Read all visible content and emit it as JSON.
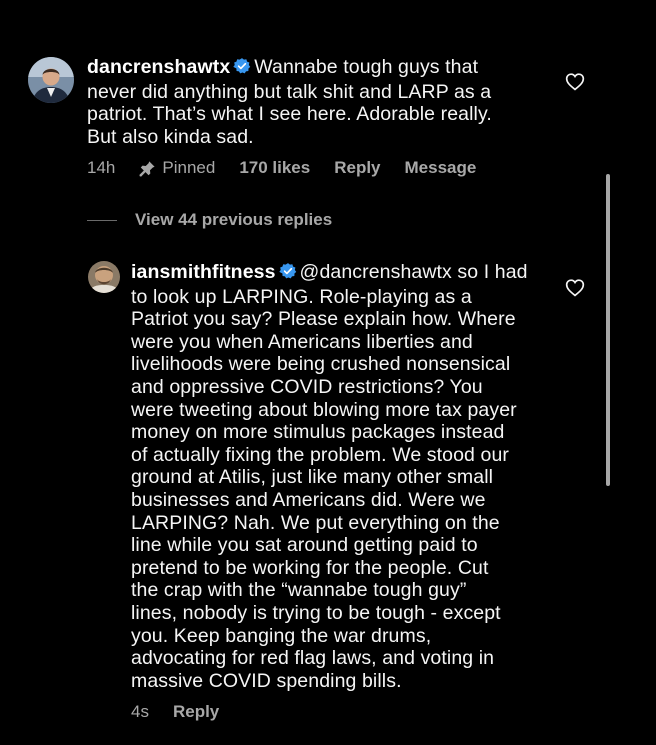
{
  "comment": {
    "username": "dancrenshawtx",
    "lines": [
      "Wannabe tough guys that",
      "never did anything but talk shit and LARP as a",
      "patriot. That’s what I see here. Adorable really.",
      "But also kinda sad."
    ],
    "time": "14h",
    "pinned_label": "Pinned",
    "likes": "170 likes",
    "reply_label": "Reply",
    "message_label": "Message"
  },
  "view_previous_replies": "View 44 previous replies",
  "reply": {
    "username": "iansmithfitness",
    "lines": [
      "@dancrenshawtx so I had",
      "to look up LARPING. Role-playing as a",
      "Patriot you say? Please explain how. Where",
      "were you when Americans liberties and",
      "livelihoods were being crushed nonsensical",
      "and oppressive COVID restrictions? You",
      "were tweeting about blowing more tax payer",
      "money on more stimulus packages instead",
      "of actually fixing the problem. We stood our",
      "ground at Atilis, just like many other small",
      "businesses and Americans did. Were we",
      "LARPING? Nah. We put everything on the",
      "line while you sat around getting paid to",
      "pretend to be working for the people. Cut",
      "the crap with the “wannabe tough guy”",
      "lines, nobody is trying to be tough - except",
      "you. Keep banging the war drums,",
      "advocating for red flag laws, and voting in",
      "massive COVID spending bills."
    ],
    "time": "4s",
    "reply_label": "Reply"
  },
  "colors": {
    "background": "#000000",
    "text": "#f5f5f5",
    "meta": "#a8a8a8",
    "verified": "#3897f0"
  },
  "icons": {
    "verified": "verified-badge-icon",
    "heart": "heart-outline-icon",
    "pin": "pushpin-icon"
  }
}
